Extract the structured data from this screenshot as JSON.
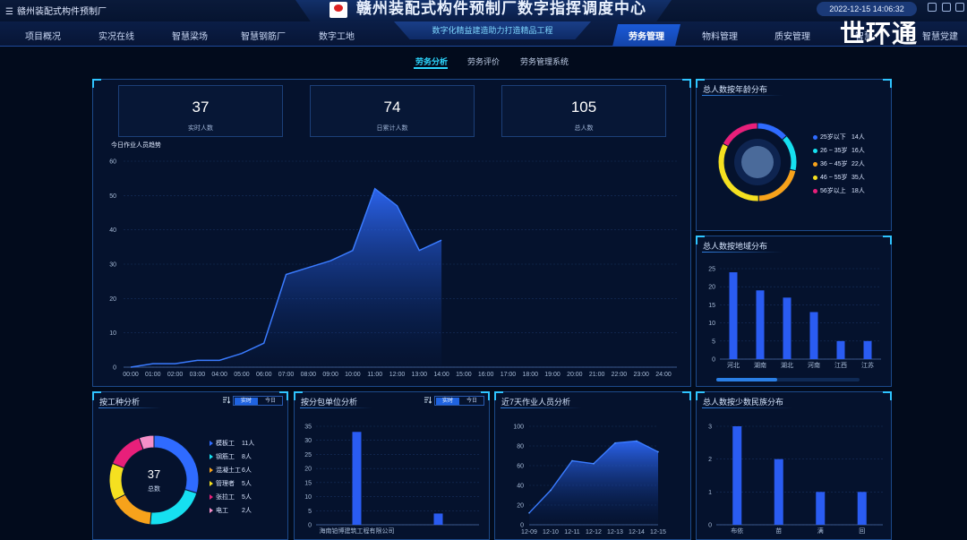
{
  "window": {
    "app_name": "赣州装配式构件预制厂",
    "title": "赣州装配式构件预制厂数字指挥调度中心",
    "datetime": "2022-12-15 14:06:32",
    "slogan": "数字化精益建造助力打造精品工程",
    "watermark": "世环通"
  },
  "nav": {
    "left": [
      "项目概况",
      "实况在线",
      "智慧梁场",
      "智慧钢筋厂",
      "数字工地"
    ],
    "right": [
      "劳务管理",
      "物料管理",
      "质安管理",
      "智慧",
      "智慧党建"
    ],
    "active": "劳务管理"
  },
  "subnav": {
    "items": [
      "劳务分析",
      "劳务评价",
      "劳务管理系统"
    ],
    "active": "劳务分析"
  },
  "stats": [
    {
      "value": "37",
      "label": "实时人数"
    },
    {
      "value": "74",
      "label": "日累计人数"
    },
    {
      "value": "105",
      "label": "总人数"
    }
  ],
  "trend": {
    "title": "今日作业人员趋势",
    "chart_data": {
      "type": "area",
      "x": [
        "00:00",
        "01:00",
        "02:00",
        "03:00",
        "04:00",
        "05:00",
        "06:00",
        "07:00",
        "08:00",
        "09:00",
        "10:00",
        "11:00",
        "12:00",
        "13:00",
        "14:00",
        "15:00",
        "16:00",
        "17:00",
        "18:00",
        "19:00",
        "20:00",
        "21:00",
        "22:00",
        "23:00",
        "24:00"
      ],
      "values": [
        0,
        1,
        1,
        2,
        2,
        4,
        7,
        27,
        29,
        31,
        34,
        52,
        47,
        34,
        37
      ],
      "ylim": [
        0,
        60
      ],
      "yticks": [
        0,
        10,
        20,
        30,
        40,
        50,
        60
      ]
    }
  },
  "age": {
    "title": "总人数按年龄分布",
    "chart_data": {
      "type": "pie",
      "categories": [
        "25岁以下",
        "26 ~ 35岁",
        "36 ~ 45岁",
        "46 ~ 55岁",
        "56岁以上"
      ],
      "values": [
        14,
        16,
        22,
        35,
        18
      ],
      "colors": [
        "#2f6bff",
        "#16e0f0",
        "#f7a21b",
        "#f5e020",
        "#e81f7a"
      ],
      "unit": "人"
    }
  },
  "region": {
    "title": "总人数按地域分布",
    "chart_data": {
      "type": "bar",
      "categories": [
        "河北",
        "湖南",
        "湖北",
        "河南",
        "江西",
        "江苏"
      ],
      "values": [
        24,
        19,
        17,
        13,
        5,
        5
      ],
      "ylim": [
        0,
        25
      ],
      "yticks": [
        0,
        5,
        10,
        15,
        20,
        25
      ]
    }
  },
  "worktype": {
    "title": "按工种分析",
    "toggle": [
      "实时",
      "今日"
    ],
    "center_value": "37",
    "center_label": "总数",
    "chart_data": {
      "type": "pie",
      "categories": [
        "模板工",
        "钢筋工",
        "混凝土工",
        "管理者",
        "张拉工",
        "电工"
      ],
      "values": [
        11,
        8,
        6,
        5,
        5,
        2
      ],
      "colors": [
        "#2f6bff",
        "#16e0f0",
        "#f7a21b",
        "#f5e020",
        "#e81f7a",
        "#f58fc8"
      ],
      "unit": "人"
    }
  },
  "subcontract": {
    "title": "按分包单位分析",
    "toggle": [
      "实时",
      "今日"
    ],
    "chart_data": {
      "type": "bar",
      "categories": [
        "海南铂博建筑工程有限公司",
        ""
      ],
      "values": [
        33,
        4
      ],
      "ylim": [
        0,
        35
      ],
      "yticks": [
        0,
        5,
        10,
        15,
        20,
        25,
        30,
        35
      ]
    }
  },
  "week": {
    "title": "近7天作业人员分析",
    "chart_data": {
      "type": "area",
      "x": [
        "12-09",
        "12-10",
        "12-11",
        "12-12",
        "12-13",
        "12-14",
        "12-15"
      ],
      "values": [
        12,
        35,
        65,
        62,
        83,
        85,
        74
      ],
      "ylim": [
        0,
        100
      ],
      "yticks": [
        0,
        20,
        40,
        60,
        80,
        100
      ]
    }
  },
  "ethnic": {
    "title": "总人数按少数民族分布",
    "chart_data": {
      "type": "bar",
      "categories": [
        "布依",
        "苗",
        "满",
        "回"
      ],
      "values": [
        3,
        2,
        1,
        1
      ],
      "ylim": [
        0,
        3
      ],
      "yticks": [
        0,
        1,
        2,
        3
      ]
    }
  }
}
